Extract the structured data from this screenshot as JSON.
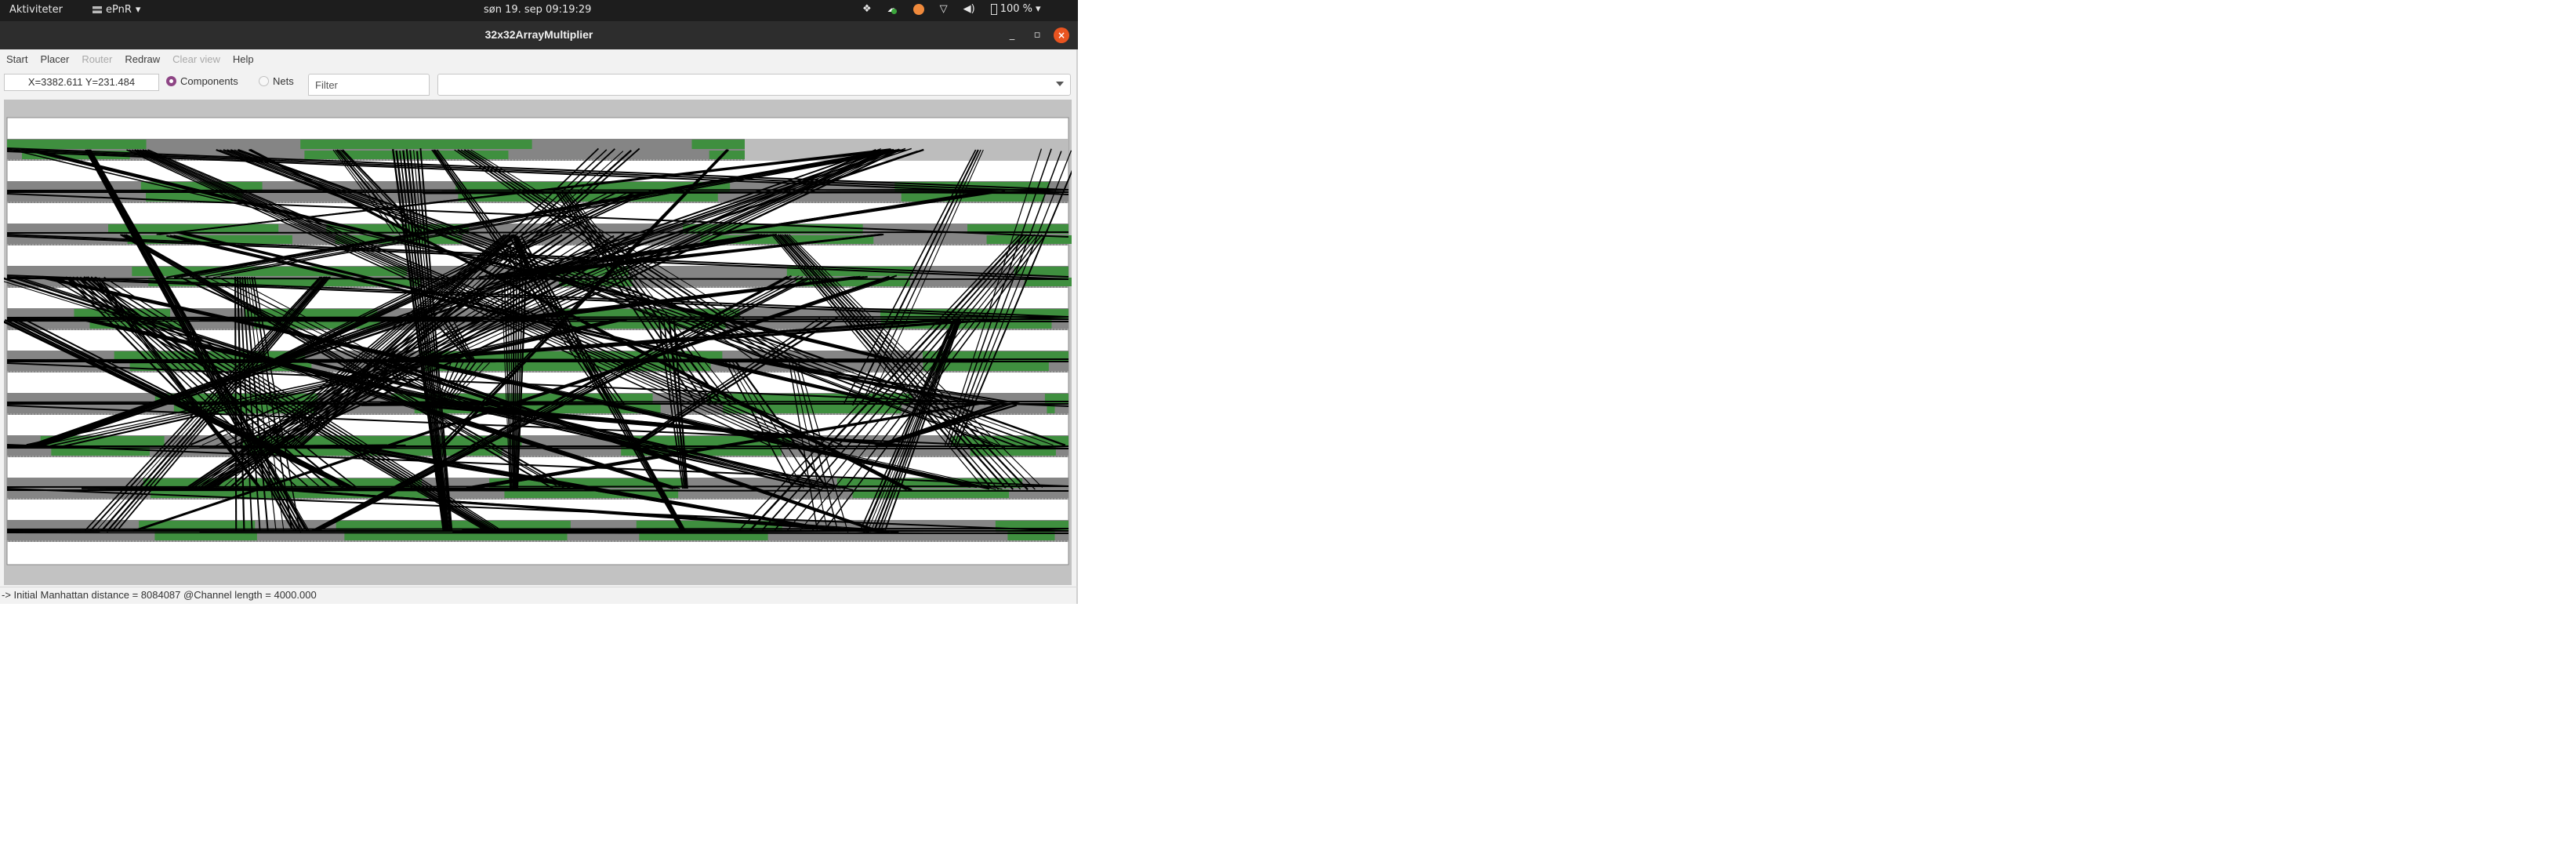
{
  "topbar": {
    "activities_label": "Aktiviteter",
    "app_menu_label": "ePnR",
    "clock": "søn 19. sep  09:19:29",
    "tray": {
      "icons": [
        "dropbox-icon",
        "cloud-sync-icon",
        "redshift-icon",
        "wifi-icon",
        "volume-icon",
        "battery-icon"
      ],
      "battery_percent": "100 %"
    }
  },
  "window": {
    "title": "32x32ArrayMultiplier",
    "minimize_glyph": "_",
    "maximize_glyph": "▫",
    "close_glyph": "×"
  },
  "menubar": {
    "items": [
      {
        "label": "Start",
        "enabled": true
      },
      {
        "label": "Placer",
        "enabled": true
      },
      {
        "label": "Router",
        "enabled": false
      },
      {
        "label": "Redraw",
        "enabled": true
      },
      {
        "label": "Clear view",
        "enabled": false
      },
      {
        "label": "Help",
        "enabled": true
      }
    ]
  },
  "toolbar": {
    "coordinates": "X=3382.611 Y=231.484",
    "radio_components": {
      "label": "Components",
      "selected": true
    },
    "radio_nets": {
      "label": "Nets",
      "selected": false
    },
    "filter_placeholder": "Filter",
    "combo_value": ""
  },
  "layout_view": {
    "row_count": 10,
    "colors": {
      "background": "#c2c2c2",
      "channel": "#ffffff",
      "row": "#858585",
      "row_empty": "#bdbdbd",
      "cell": "#3f8f3f",
      "net": "#000000"
    }
  },
  "status": {
    "message": "-> Initial Manhattan distance = 8084087 @Channel length = 4000.000"
  }
}
